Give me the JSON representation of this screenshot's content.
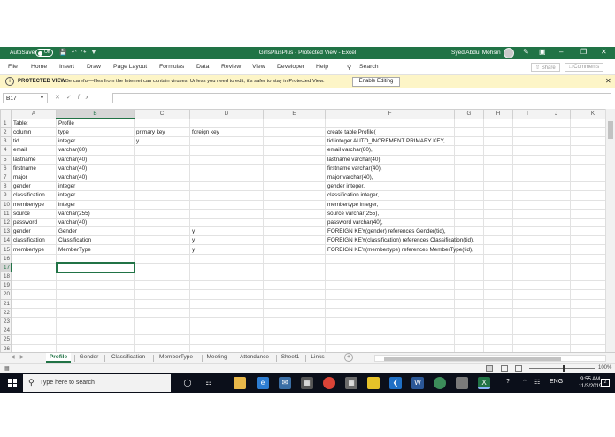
{
  "window": {
    "autosave_label": "AutoSave",
    "autosave_state": "Off",
    "title": "GirlsPlusPlus - Protected View - Excel",
    "user_name": "Syed Abdul Mohsin"
  },
  "menu": {
    "items": [
      "File",
      "Home",
      "Insert",
      "Draw",
      "Page Layout",
      "Formulas",
      "Data",
      "Review",
      "View",
      "Developer",
      "Help"
    ],
    "search_label": "Search",
    "share_label": "Share",
    "comments_label": "Comments"
  },
  "protected_view": {
    "title": "PROTECTED VIEW",
    "message": "Be careful—files from the Internet can contain viruses. Unless you need to edit, it's safer to stay in Protected View.",
    "enable_button": "Enable Editing"
  },
  "formula_bar": {
    "name_box": "B17",
    "fx_label": "fx",
    "formula": ""
  },
  "grid": {
    "columns": [
      "A",
      "B",
      "C",
      "D",
      "E",
      "F",
      "G",
      "H",
      "I",
      "J",
      "K"
    ],
    "selected_cell": "B17",
    "rows": [
      {
        "n": "1",
        "cells": [
          "Table:",
          "Profile",
          "",
          "",
          "",
          "",
          "",
          "",
          "",
          "",
          ""
        ]
      },
      {
        "n": "2",
        "cells": [
          "column",
          "type",
          "primary key",
          "foreign key",
          "",
          "create table Profile(",
          "",
          "",
          "",
          "",
          ""
        ]
      },
      {
        "n": "3",
        "cells": [
          "tid",
          "integer",
          "y",
          "",
          "",
          "tid integer AUTO_INCREMENT PRIMARY KEY,",
          "",
          "",
          "",
          "",
          ""
        ]
      },
      {
        "n": "4",
        "cells": [
          "email",
          "varchar(80)",
          "",
          "",
          "",
          "email varchar(80),",
          "",
          "",
          "",
          "",
          ""
        ]
      },
      {
        "n": "5",
        "cells": [
          "lastname",
          "varchar(40)",
          "",
          "",
          "",
          "lastname varchar(40),",
          "",
          "",
          "",
          "",
          ""
        ]
      },
      {
        "n": "6",
        "cells": [
          "firstname",
          "varchar(40)",
          "",
          "",
          "",
          "firstname varchar(40),",
          "",
          "",
          "",
          "",
          ""
        ]
      },
      {
        "n": "7",
        "cells": [
          "major",
          "varchar(40)",
          "",
          "",
          "",
          "major varchar(40),",
          "",
          "",
          "",
          "",
          ""
        ]
      },
      {
        "n": "8",
        "cells": [
          "gender",
          "integer",
          "",
          "",
          "",
          "gender integer,",
          "",
          "",
          "",
          "",
          ""
        ]
      },
      {
        "n": "9",
        "cells": [
          "classification",
          "integer",
          "",
          "",
          "",
          "classification integer,",
          "",
          "",
          "",
          "",
          ""
        ]
      },
      {
        "n": "10",
        "cells": [
          "membertype",
          "integer",
          "",
          "",
          "",
          "membertype integer,",
          "",
          "",
          "",
          "",
          ""
        ]
      },
      {
        "n": "11",
        "cells": [
          "source",
          "varchar(255)",
          "",
          "",
          "",
          "source varchar(255),",
          "",
          "",
          "",
          "",
          ""
        ]
      },
      {
        "n": "12",
        "cells": [
          "password",
          "varchar(40)",
          "",
          "",
          "",
          "password varchar(40),",
          "",
          "",
          "",
          "",
          ""
        ]
      },
      {
        "n": "13",
        "cells": [
          "gender",
          "Gender",
          "",
          "y",
          "",
          "FOREIGN KEY(gender) references Gender(tid),",
          "",
          "",
          "",
          "",
          ""
        ]
      },
      {
        "n": "14",
        "cells": [
          "classification",
          "Classification",
          "",
          "y",
          "",
          "FOREIGN KEY(classification) references Classification(tid),",
          "",
          "",
          "",
          "",
          ""
        ]
      },
      {
        "n": "15",
        "cells": [
          "membertype",
          "MemberType",
          "",
          "y",
          "",
          "FOREIGN KEY(membertype) references MemberType(tid),",
          "",
          "",
          "",
          "",
          ""
        ]
      },
      {
        "n": "16",
        "cells": [
          "",
          "",
          "",
          "",
          "",
          "",
          "",
          "",
          "",
          "",
          ""
        ]
      },
      {
        "n": "17",
        "cells": [
          "",
          "",
          "",
          "",
          "",
          "",
          "",
          "",
          "",
          "",
          ""
        ]
      },
      {
        "n": "18",
        "cells": [
          "",
          "",
          "",
          "",
          "",
          "",
          "",
          "",
          "",
          "",
          ""
        ]
      },
      {
        "n": "19",
        "cells": [
          "",
          "",
          "",
          "",
          "",
          "",
          "",
          "",
          "",
          "",
          ""
        ]
      },
      {
        "n": "20",
        "cells": [
          "",
          "",
          "",
          "",
          "",
          "",
          "",
          "",
          "",
          "",
          ""
        ]
      },
      {
        "n": "21",
        "cells": [
          "",
          "",
          "",
          "",
          "",
          "",
          "",
          "",
          "",
          "",
          ""
        ]
      },
      {
        "n": "22",
        "cells": [
          "",
          "",
          "",
          "",
          "",
          "",
          "",
          "",
          "",
          "",
          ""
        ]
      },
      {
        "n": "23",
        "cells": [
          "",
          "",
          "",
          "",
          "",
          "",
          "",
          "",
          "",
          "",
          ""
        ]
      },
      {
        "n": "24",
        "cells": [
          "",
          "",
          "",
          "",
          "",
          "",
          "",
          "",
          "",
          "",
          ""
        ]
      },
      {
        "n": "25",
        "cells": [
          "",
          "",
          "",
          "",
          "",
          "",
          "",
          "",
          "",
          "",
          ""
        ]
      },
      {
        "n": "26",
        "cells": [
          "",
          "",
          "",
          "",
          "",
          "",
          "",
          "",
          "",
          "",
          ""
        ]
      }
    ]
  },
  "sheets": {
    "tabs": [
      "Profile",
      "Gender",
      "Classification",
      "MemberType",
      "Meeting",
      "Attendance",
      "Sheet1",
      "Links"
    ],
    "active": "Profile"
  },
  "status": {
    "zoom": "100%"
  },
  "taskbar": {
    "search_placeholder": "Type here to search",
    "language": "ENG",
    "time": "9:55 AM",
    "date": "11/3/2019",
    "notifications": "2"
  },
  "colors": {
    "excel_green": "#217346",
    "protected_yellow": "#fdf5c7",
    "taskbar": "#0b0f1a"
  }
}
